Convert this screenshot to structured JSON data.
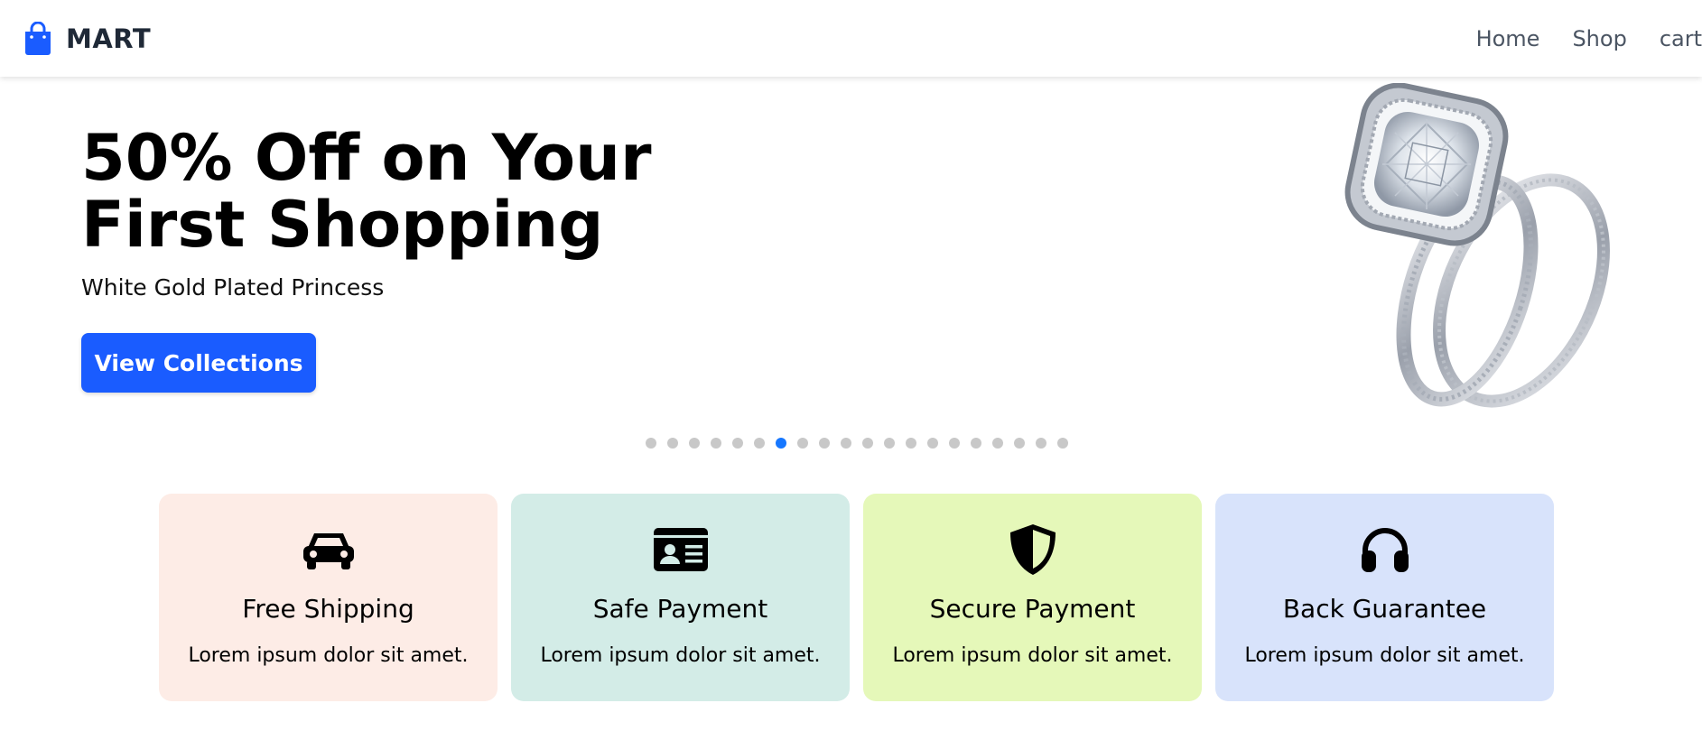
{
  "header": {
    "brand_name": "MART",
    "brand_icon": "shopping-bag-icon",
    "brand_color": "#1a5cff",
    "nav": [
      {
        "label": "Home"
      },
      {
        "label": "Shop"
      },
      {
        "label": "cart"
      }
    ]
  },
  "hero": {
    "title_line1": "50% Off on Your",
    "title_line2": "First Shopping",
    "subtitle": "White Gold Plated Princess",
    "cta_label": "View Collections",
    "image": "diamond-ring-image"
  },
  "carousel": {
    "dot_count": 20,
    "active_index": 6,
    "active_color": "#1677ff",
    "inactive_color": "#c8c8c8"
  },
  "features": [
    {
      "icon": "car-icon",
      "title": "Free Shipping",
      "text": "Lorem ipsum dolor sit amet.",
      "bg": "#fdece6"
    },
    {
      "icon": "id-card-icon",
      "title": "Safe Payment",
      "text": "Lorem ipsum dolor sit amet.",
      "bg": "#d3ece7"
    },
    {
      "icon": "shield-icon",
      "title": "Secure Payment",
      "text": "Lorem ipsum dolor sit amet.",
      "bg": "#e5f8b9"
    },
    {
      "icon": "headphones-icon",
      "title": "Back Guarantee",
      "text": "Lorem ipsum dolor sit amet.",
      "bg": "#d8e3fb"
    }
  ]
}
